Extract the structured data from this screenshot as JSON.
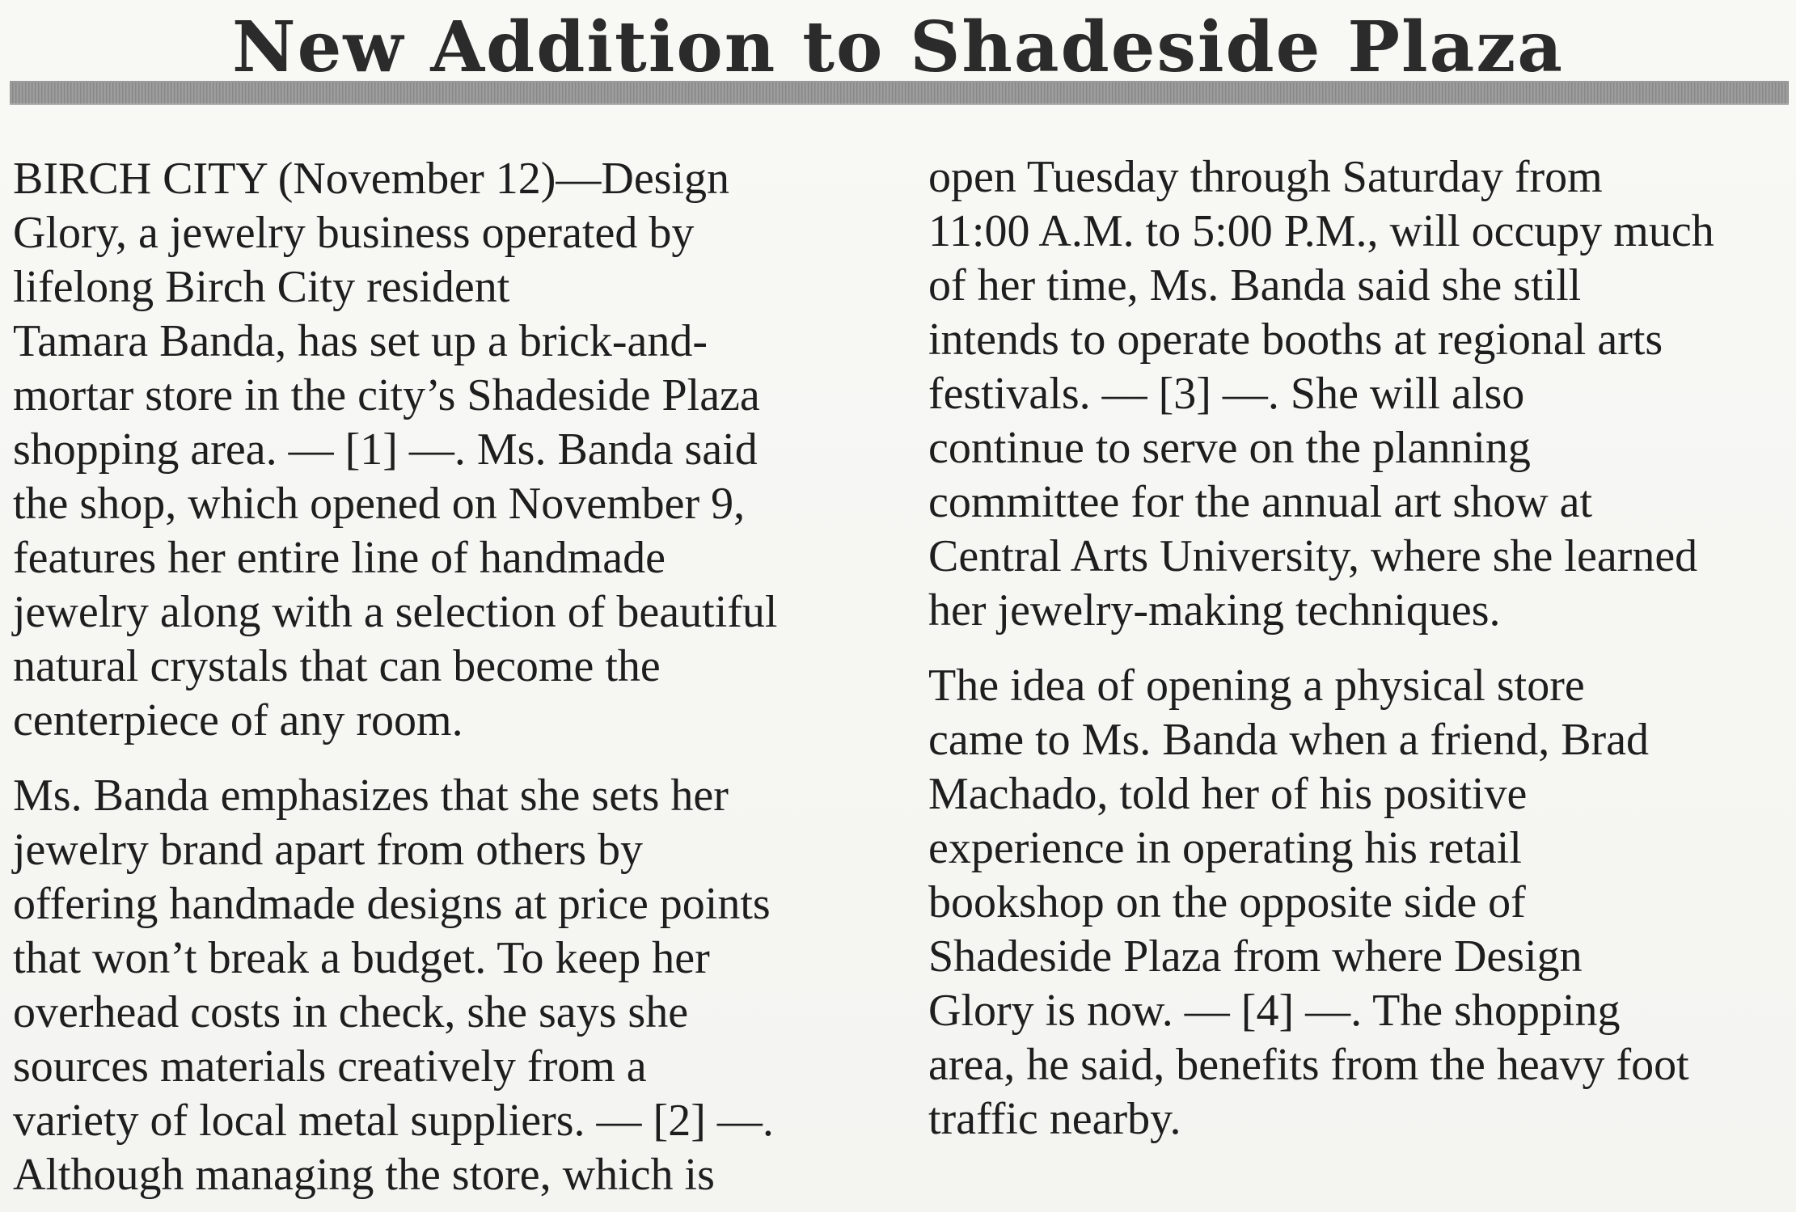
{
  "article": {
    "headline": "New Addition to Shadeside Plaza",
    "left_column": {
      "paragraph_1": [
        "BIRCH CITY (November 12)—Design",
        "Glory, a jewelry business operated by",
        "lifelong Birch City resident",
        "Tamara Banda, has set up a brick-and-",
        "mortar store in the city’s Shadeside Plaza",
        "shopping area. — [1] —. Ms. Banda said",
        "the shop, which opened on November 9,",
        "features her entire line of handmade",
        "jewelry along with a selection of beautiful",
        "natural crystals that can become the",
        "centerpiece of any room."
      ],
      "paragraph_2": [
        "Ms. Banda emphasizes that she sets her",
        "jewelry brand apart from others by",
        "offering handmade designs at price points",
        "that won’t break a budget. To keep her",
        "overhead costs in check, she says she",
        "sources materials creatively from a",
        "variety of local metal suppliers. — [2] —.",
        "Although managing the store, which is"
      ]
    },
    "right_column": {
      "paragraph_2_cont": [
        "open Tuesday through Saturday from",
        "11:00 A.M. to 5:00 P.M., will occupy much",
        "of her time, Ms. Banda said she still",
        "intends to operate booths at regional arts",
        "festivals. — [3] —. She will also",
        "continue to serve on the planning",
        "committee for the annual art show at",
        "Central Arts University, where she learned",
        "her jewelry-making techniques."
      ],
      "paragraph_3": [
        "The idea of opening a physical store",
        "came to Ms. Banda when a friend, Brad",
        "Machado, told her of his positive",
        "experience in operating his retail",
        "bookshop on the opposite side of",
        "Shadeside Plaza from where Design",
        "Glory is now. — [4] —. The shopping",
        "area, he said, benefits from the heavy foot",
        "traffic nearby."
      ]
    }
  }
}
